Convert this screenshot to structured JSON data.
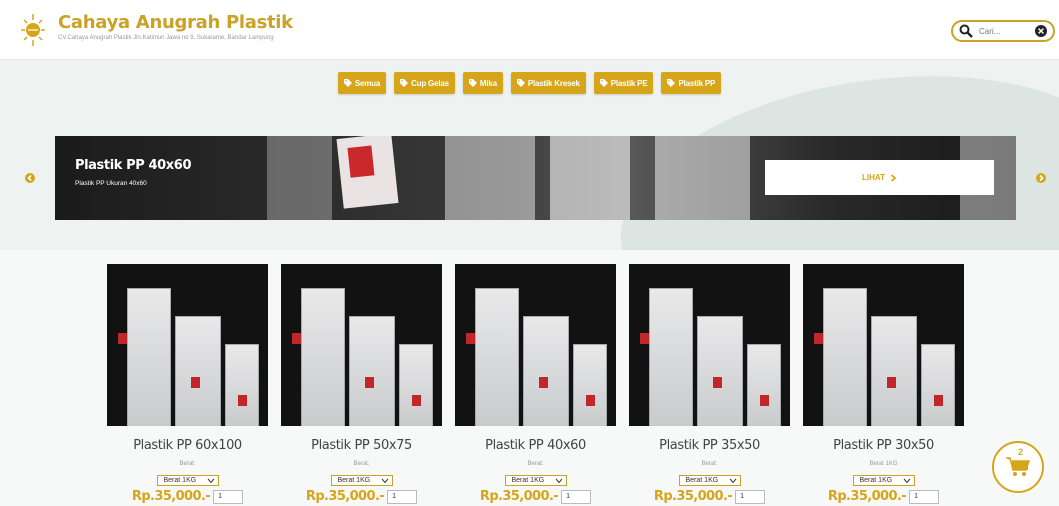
{
  "header": {
    "brand": "Cahaya Anugrah Plastik",
    "subtitle": "CV.Cahaya Anugrah Plastik Jln.Katimun Jawa no 9, Sukarame, Bandar Lampung",
    "search_placeholder": "Cari..."
  },
  "filters": [
    "Semua",
    "Cup Gelas",
    "Mika",
    "Plastik Kresek",
    "Plastik PE",
    "Plastik PP"
  ],
  "slider": {
    "title": "Plastik PP 40x60",
    "subtitle": "Plastik PP Ukuran 40x60",
    "button": "LIHAT"
  },
  "products": [
    {
      "name": "Plastik PP 60x100",
      "berat": "Berat:",
      "option": "Berat 1KG",
      "price": "Rp.35,000.-",
      "qty": "1"
    },
    {
      "name": "Plastik PP 50x75",
      "berat": "Berat:",
      "option": "Berat 1KG",
      "price": "Rp.35,000.-",
      "qty": "1"
    },
    {
      "name": "Plastik PP 40x60",
      "berat": "Berat:",
      "option": "Berat 1KG",
      "price": "Rp.35,000.-",
      "qty": "1"
    },
    {
      "name": "Plastik PP 35x50",
      "berat": "Berat:",
      "option": "Berat 1KG",
      "price": "Rp.35,000.-",
      "qty": "1"
    },
    {
      "name": "Plastik PP 30x50",
      "berat": "Berat 1KG",
      "option": "Berat 1KG",
      "price": "Rp.35,000.-",
      "qty": "1"
    }
  ],
  "cart": {
    "count": "2"
  },
  "colors": {
    "accent": "#d7a51a",
    "brand": "#c9a227"
  }
}
